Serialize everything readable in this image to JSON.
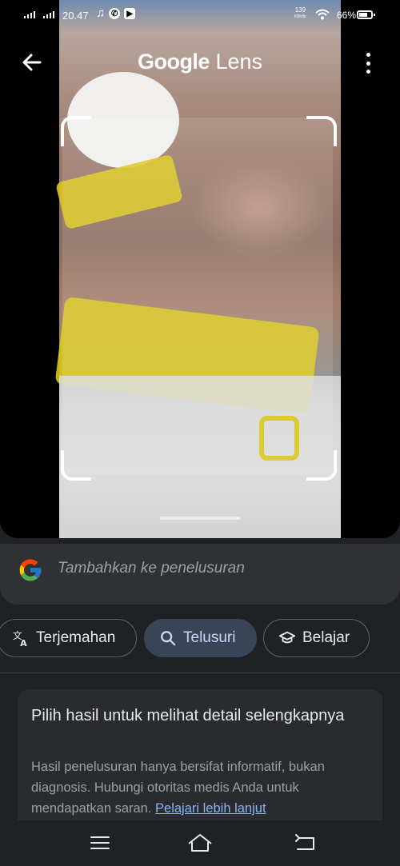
{
  "status_bar": {
    "time": "20.47",
    "net_speed_value": "139",
    "net_speed_unit": "KB/dtk",
    "battery": "66%"
  },
  "header": {
    "title_brand": "Google",
    "title_product": "Lens"
  },
  "search": {
    "placeholder": "Tambahkan ke penelusuran"
  },
  "modes": [
    {
      "label": "Terjemahan",
      "icon": "translate-icon",
      "selected": false
    },
    {
      "label": "Telusuri",
      "icon": "search-icon",
      "selected": true
    },
    {
      "label": "Belajar",
      "icon": "school-icon",
      "selected": false
    }
  ],
  "results": {
    "title": "Pilih hasil untuk melihat detail selengkapnya",
    "disclaimer": "Hasil penelusuran hanya bersifat informatif, bukan diagnosis. Hubungi otoritas medis Anda untuk mendapatkan saran.",
    "link": "Pelajari lebih lanjut"
  },
  "colors": {
    "background": "#202124",
    "accent_chip": "#394457",
    "link": "#8ab4f8"
  }
}
